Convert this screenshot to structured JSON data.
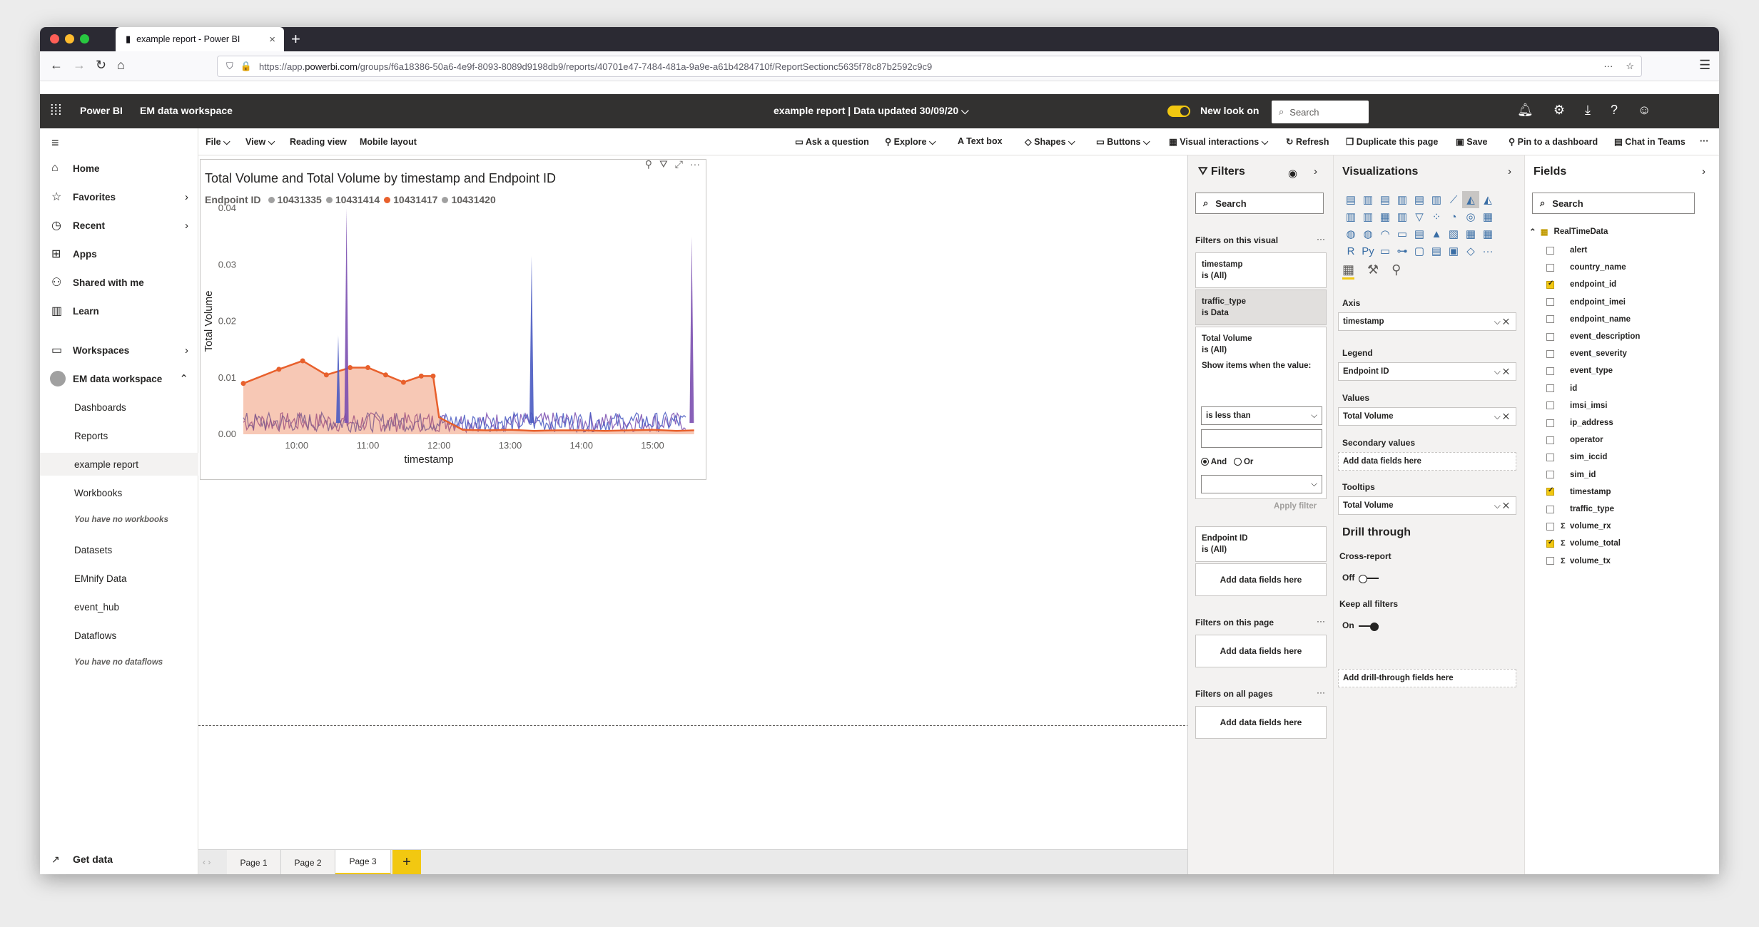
{
  "browser": {
    "tab_title": "example report - Power BI",
    "url_prefix": "https://app.",
    "url_host": "powerbi.com",
    "url_rest": "/groups/f6a18386-50a6-4e9f-8093-8089d9198db9/reports/40701e47-7484-481a-9a9e-a61b4284710f/ReportSectionc5635f78c87b2592c9c9"
  },
  "header": {
    "brand": "Power BI",
    "workspace": "EM data workspace",
    "report_title": "example report  |  Data updated 30/09/20",
    "new_look": "New look on",
    "search_placeholder": "Search"
  },
  "sidebar": {
    "items": [
      {
        "label": "Home",
        "icon": "home-icon"
      },
      {
        "label": "Favorites",
        "icon": "star-icon"
      },
      {
        "label": "Recent",
        "icon": "clock-icon"
      },
      {
        "label": "Apps",
        "icon": "apps-icon"
      },
      {
        "label": "Shared with me",
        "icon": "shared-icon"
      },
      {
        "label": "Learn",
        "icon": "book-icon"
      },
      {
        "label": "Workspaces",
        "icon": "workspaces-icon"
      },
      {
        "label": "EM data workspace",
        "icon": "workspace-avatar"
      }
    ],
    "sub_items": [
      "Dashboards",
      "Reports",
      "example report",
      "Workbooks",
      "You have no workbooks",
      "Datasets",
      "EMnify Data",
      "event_hub",
      "Dataflows",
      "You have no dataflows"
    ],
    "get_data": "Get data"
  },
  "ribbon": {
    "left": [
      "File",
      "View",
      "Reading view",
      "Mobile layout"
    ],
    "right": [
      "Ask a question",
      "Explore",
      "Text box",
      "Shapes",
      "Buttons",
      "Visual interactions",
      "Refresh",
      "Duplicate this page",
      "Save",
      "Pin to a dashboard",
      "Chat in Teams"
    ]
  },
  "visual": {
    "title": "Total Volume and Total Volume by timestamp and Endpoint ID",
    "legend_title": "Endpoint ID",
    "legend_items": [
      "10431335",
      "10431414",
      "10431417",
      "10431420"
    ]
  },
  "chart_data": {
    "type": "line",
    "title": "Total Volume and Total Volume by timestamp and Endpoint ID",
    "xlabel": "timestamp",
    "ylabel": "Total Volume",
    "x_ticks": [
      "10:00",
      "11:00",
      "12:00",
      "13:00",
      "14:00",
      "15:00"
    ],
    "y_ticks": [
      "0.00",
      "0.01",
      "0.02",
      "0.03",
      "0.04"
    ],
    "ylim": [
      0,
      0.04
    ],
    "xlim": [
      "09:15",
      "15:40"
    ],
    "series": [
      {
        "name": "10431417",
        "color": "#e8602c",
        "x": [
          "09:15",
          "09:45",
          "10:05",
          "10:25",
          "10:45",
          "11:00",
          "11:15",
          "11:30",
          "11:45",
          "11:55",
          "12:00",
          "12:20",
          "12:40",
          "13:00",
          "13:20",
          "13:40",
          "14:00",
          "14:20",
          "14:40",
          "15:00",
          "15:20",
          "15:35"
        ],
        "values": [
          0.009,
          0.0115,
          0.013,
          0.0105,
          0.0118,
          0.0118,
          0.0105,
          0.0092,
          0.0103,
          0.0103,
          0.003,
          0.0008,
          0.0007,
          0.0008,
          0.0006,
          0.0007,
          0.0007,
          0.0006,
          0.0007,
          0.0008,
          0.0006,
          0.0007
        ]
      },
      {
        "name": "10431335",
        "color": "#4a5bc2",
        "x": [
          "10:35",
          "10:42",
          "13:18",
          "15:33"
        ],
        "values": [
          0.0175,
          0.04,
          0.0315,
          0.035
        ]
      }
    ],
    "grid": false,
    "legend_position": "top-left"
  },
  "filters": {
    "title": "Filters",
    "search": "Search",
    "on_visual": "Filters on this visual",
    "cards": [
      {
        "field": "timestamp",
        "state": "is (All)"
      },
      {
        "field": "traffic_type",
        "state": "is Data"
      },
      {
        "field": "Total Volume",
        "state": "is (All)"
      },
      {
        "field": "Endpoint ID",
        "state": "is (All)"
      }
    ],
    "show_items": "Show items when the value:",
    "condition": "is less than",
    "and_label": "And",
    "or_label": "Or",
    "apply": "Apply filter",
    "add_fields": "Add data fields here",
    "on_page": "Filters on this page",
    "on_all": "Filters on all pages"
  },
  "visualizations": {
    "title": "Visualizations",
    "axis": "Axis",
    "axis_field": "timestamp",
    "legend": "Legend",
    "legend_field": "Endpoint ID",
    "values": "Values",
    "values_field": "Total Volume",
    "secondary": "Secondary values",
    "secondary_empty": "Add data fields here",
    "tooltips": "Tooltips",
    "tooltips_field": "Total Volume",
    "drill": "Drill through",
    "cross_report": "Cross-report",
    "off": "Off",
    "keep_filters": "Keep all filters",
    "on": "On",
    "drill_empty": "Add drill-through fields here"
  },
  "fields": {
    "title": "Fields",
    "search": "Search",
    "table": "RealTimeData",
    "items": [
      {
        "name": "alert",
        "checked": false,
        "sigma": false
      },
      {
        "name": "country_name",
        "checked": false,
        "sigma": false
      },
      {
        "name": "endpoint_id",
        "checked": true,
        "sigma": false
      },
      {
        "name": "endpoint_imei",
        "checked": false,
        "sigma": false
      },
      {
        "name": "endpoint_name",
        "checked": false,
        "sigma": false
      },
      {
        "name": "event_description",
        "checked": false,
        "sigma": false
      },
      {
        "name": "event_severity",
        "checked": false,
        "sigma": false
      },
      {
        "name": "event_type",
        "checked": false,
        "sigma": false
      },
      {
        "name": "id",
        "checked": false,
        "sigma": false
      },
      {
        "name": "imsi_imsi",
        "checked": false,
        "sigma": false
      },
      {
        "name": "ip_address",
        "checked": false,
        "sigma": false
      },
      {
        "name": "operator",
        "checked": false,
        "sigma": false
      },
      {
        "name": "sim_iccid",
        "checked": false,
        "sigma": false
      },
      {
        "name": "sim_id",
        "checked": false,
        "sigma": false
      },
      {
        "name": "timestamp",
        "checked": true,
        "sigma": false
      },
      {
        "name": "traffic_type",
        "checked": false,
        "sigma": false
      },
      {
        "name": "volume_rx",
        "checked": false,
        "sigma": true
      },
      {
        "name": "volume_total",
        "checked": true,
        "sigma": true
      },
      {
        "name": "volume_tx",
        "checked": false,
        "sigma": true
      }
    ]
  },
  "pages": [
    "Page 1",
    "Page 2",
    "Page 3"
  ]
}
